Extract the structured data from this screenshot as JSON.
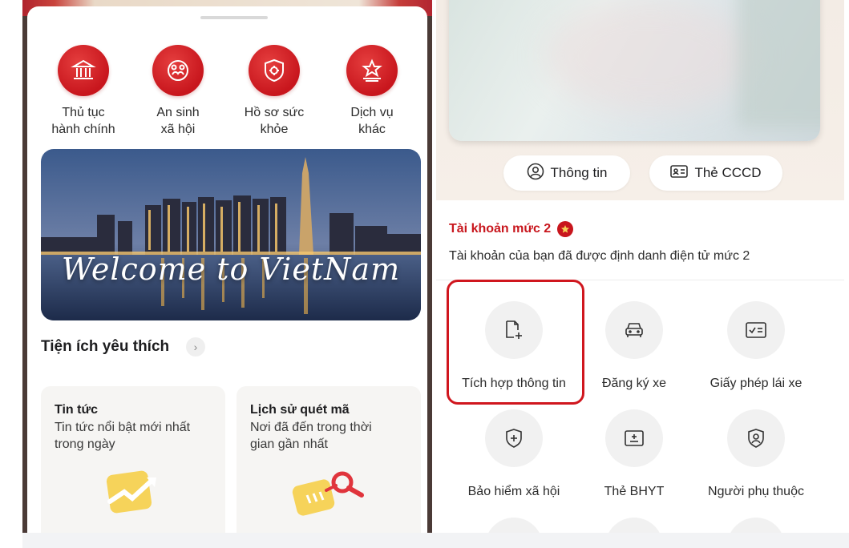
{
  "left": {
    "categories": [
      {
        "line1": "Thủ tục",
        "line2": "hành chính",
        "icon": "government-building-icon"
      },
      {
        "line1": "An sinh",
        "line2": "xã hội",
        "icon": "family-care-icon"
      },
      {
        "line1": "Hồ sơ sức",
        "line2": "khỏe",
        "icon": "health-shield-icon"
      },
      {
        "line1": "Dịch vụ",
        "line2": "khác",
        "icon": "star-stand-icon"
      }
    ],
    "banner": {
      "text": "Welcome to VietNam"
    },
    "favorites": {
      "title": "Tiện ích yêu thích",
      "chevron": "›",
      "cards": [
        {
          "title": "Tin tức",
          "line1": "Tin tức nổi bật mới nhất",
          "line2": "trong ngày",
          "icon": "trending-chart-icon"
        },
        {
          "title": "Lịch sử quét mã",
          "line1": "Nơi đã đến trong thời",
          "line2": "gian gần nhất",
          "icon": "scan-history-icon"
        }
      ]
    }
  },
  "right": {
    "pills": {
      "info": "Thông tin",
      "cccd": "Thẻ CCCD"
    },
    "account": {
      "title": "Tài khoản mức 2",
      "description": "Tài khoản của bạn đã được định danh điện tử mức 2"
    },
    "services": [
      {
        "label": "Tích hợp thông tin",
        "icon": "document-add-icon"
      },
      {
        "label": "Đăng ký xe",
        "icon": "car-icon"
      },
      {
        "label": "Giấy phép lái xe",
        "icon": "license-card-icon"
      },
      {
        "label": "Bảo hiểm xã hội",
        "icon": "shield-plus-icon"
      },
      {
        "label": "Thẻ BHYT",
        "icon": "health-card-icon"
      },
      {
        "label": "Người phụ thuộc",
        "icon": "dependent-person-icon"
      }
    ]
  },
  "colors": {
    "brand_red": "#c8161d",
    "highlight_border": "#d0161e"
  }
}
